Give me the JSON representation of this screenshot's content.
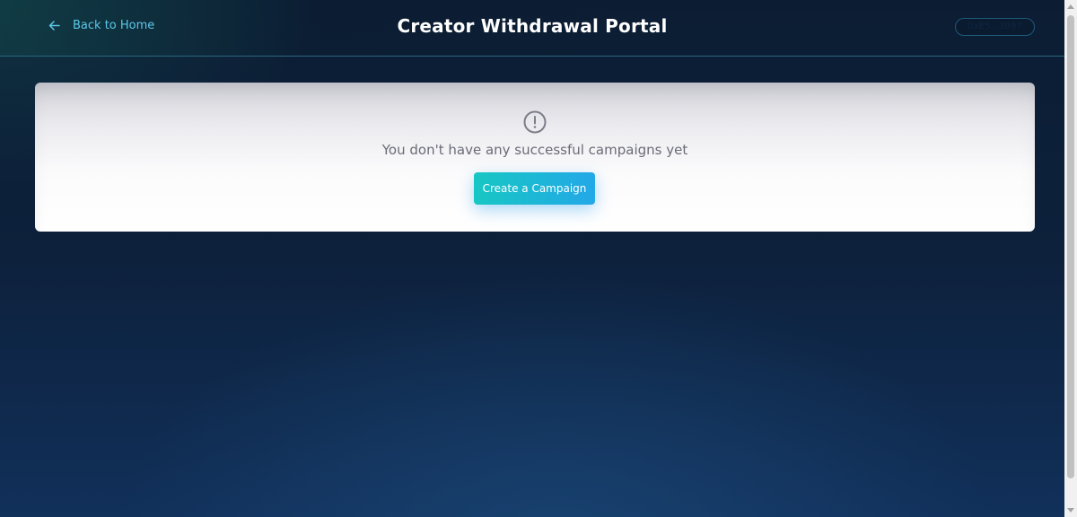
{
  "header": {
    "back_link": {
      "icon": "arrow-left-icon",
      "label": "Back to Home"
    },
    "title": "Creator Withdrawal Portal",
    "wallet_address": "0xE5...3B97"
  },
  "empty_state": {
    "icon": "alert-circle-icon",
    "message": "You don't have any successful campaigns yet",
    "button_label": "Create a Campaign"
  },
  "colors": {
    "accent_link": "#5cc8e8",
    "button_gradient_start": "#17c7c3",
    "button_gradient_end": "#23a8e8",
    "background_dark": "#0c1d33"
  }
}
